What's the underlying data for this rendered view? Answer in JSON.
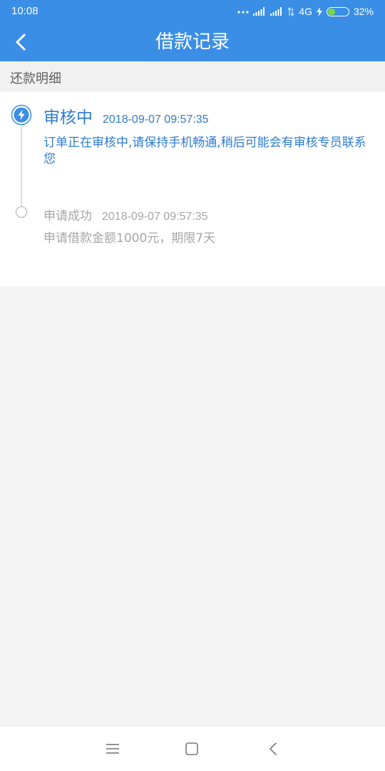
{
  "status_bar": {
    "time": "10:08",
    "network": "4G",
    "battery_percent": "32%",
    "battery_level": 0.32,
    "icons": [
      "more-dots-icon",
      "signal-icon",
      "signal-icon",
      "data-transfer-icon",
      "charging-icon",
      "battery-icon"
    ]
  },
  "header": {
    "title": "借款记录",
    "back_icon": "chevron-left-icon"
  },
  "section": {
    "title": "还款明细"
  },
  "timeline": [
    {
      "status": "审核中",
      "time": "2018-09-07 09:57:35",
      "description": "订单正在审核中,请保持手机畅通,稍后可能会有审核专员联系您",
      "icon": "lightning-icon",
      "active": true
    },
    {
      "status": "申请成功",
      "time": "2018-09-07 09:57:35",
      "description": "申请借款金额1000元，期限7天",
      "icon": "circle-icon",
      "active": false
    }
  ],
  "colors": {
    "primary": "#3a8ee6",
    "active_text": "#2e7bd1",
    "inactive_text": "#a6a6a6",
    "background": "#f3f3f3"
  },
  "nav_bar": {
    "icons": [
      "menu-icon",
      "home-square-icon",
      "back-chevron-icon"
    ]
  }
}
